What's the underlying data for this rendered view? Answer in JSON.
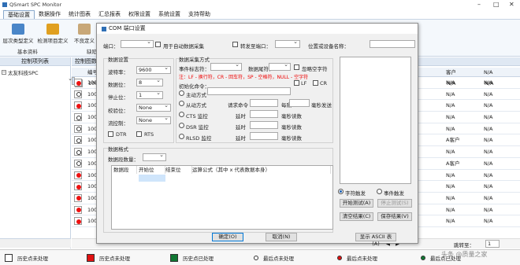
{
  "app": {
    "title": "QSmart SPC Monitor"
  },
  "menu": {
    "tabs": [
      "基础设置",
      "数据操作",
      "统计图表",
      "汇总报表",
      "权限设置",
      "系统设置",
      "支持帮助"
    ]
  },
  "ribbon": {
    "buttons": [
      "层次类型定义",
      "检测项目定义",
      "不良定义"
    ],
    "groups": [
      "基本资料",
      "缺陷"
    ]
  },
  "left_panel": {
    "header": "控制项列表",
    "tree_root": "太友科技SPC"
  },
  "main_panel": {
    "header": "控制图数量"
  },
  "table": {
    "columns": {
      "code": "编号",
      "customer": "客户",
      "extra": "N/A"
    },
    "rows": [
      {
        "status": "green",
        "code": "100",
        "col_a": "N/A",
        "col_b": "N/A",
        "selected": true
      },
      {
        "status": "red",
        "code": "100",
        "col_a": "N/A",
        "col_b": "N/A"
      },
      {
        "status": "hollow",
        "code": "100",
        "col_a": "N/A",
        "col_b": "N/A"
      },
      {
        "status": "red",
        "code": "100",
        "col_a": "N/A",
        "col_b": "N/A"
      },
      {
        "status": "hollow",
        "code": "100",
        "col_a": "N/A",
        "col_b": "N/A"
      },
      {
        "status": "hollow",
        "code": "100",
        "col_a": "N/A",
        "col_b": "N/A"
      },
      {
        "status": "hollow",
        "code": "100",
        "col_a": "A客户",
        "col_b": "N/A"
      },
      {
        "status": "hollow",
        "code": "100",
        "col_a": "N/A",
        "col_b": "N/A"
      },
      {
        "status": "hollow",
        "code": "100",
        "col_a": "A客户",
        "col_b": "N/A"
      },
      {
        "status": "red",
        "code": "100",
        "col_a": "N/A",
        "col_b": "N/A"
      },
      {
        "status": "red",
        "code": "100",
        "col_a": "N/A",
        "col_b": "N/A"
      },
      {
        "status": "red",
        "code": "100",
        "col_a": "N/A",
        "col_b": "N/A"
      },
      {
        "status": "red",
        "code": "100",
        "col_a": "N/A",
        "col_b": "N/A"
      },
      {
        "status": "red",
        "code": "100",
        "col_a": "N/A",
        "col_b": "N/A"
      }
    ]
  },
  "pager": {
    "jump_label": "跳转至：",
    "page": "1"
  },
  "legend": [
    {
      "label": "历史点未处理",
      "kind": "square",
      "color": "#ffffff"
    },
    {
      "label": "历史点未处理",
      "kind": "square",
      "color": "#e11111"
    },
    {
      "label": "历史点已处理",
      "kind": "square",
      "color": "#117733"
    },
    {
      "label": "最后点未处理",
      "kind": "circle",
      "color": "#ffffff"
    },
    {
      "label": "最后点未处理",
      "kind": "circle",
      "color": "#e11111"
    },
    {
      "label": "最后点已处理",
      "kind": "circle",
      "color": "#117733"
    }
  ],
  "watermark": "头条 @质量之家",
  "dialog": {
    "title": "COM 端口设置",
    "port_label": "端口：",
    "auto_detect_label": "用于自动数据采集",
    "forward_label": "转发至端口：",
    "device_name_label": "位置或设备名称：",
    "params_group": "数据设置",
    "baud_label": "波特率：",
    "baud_value": "9600",
    "databits_label": "数据位：",
    "databits_value": "8",
    "stopbits_label": "停止位：",
    "stopbits_value": "1",
    "parity_label": "校验位：",
    "parity_value": "None",
    "flow_label": "流控制：",
    "flow_value": "None",
    "dtr_label": "DTR",
    "rts_label": "RTS",
    "collect_group": "数据采集方式",
    "event_flag_label": "事件标志符：",
    "data_end_label": "数据尾符：",
    "ignore_blank_label": "忽略空字符",
    "hint": "注：LF - 换行符，CR - 回车符，SP - 空格符，NULL - 空字符",
    "init_cmd_label": "初始化命令：",
    "lf_label": "LF",
    "cr_label": "CR",
    "active_label": "主动方式",
    "passive_label": "从动方式",
    "request_cmd_label": "请求命令",
    "interval_label": "每隔",
    "send_label": "毫秒发送",
    "cts_label": "CTS 监控",
    "dsr_label": "DSR 监控",
    "rlsd_label": "RLSD 监控",
    "delay_label": "延时",
    "read_label": "毫秒读数",
    "format_group": "数据格式",
    "field_count_label": "数据段数量：",
    "grid_headers": [
      "数据段",
      "开始位",
      "结束位",
      "运算公式（其中 x 代表数据本身）"
    ],
    "char_trigger_label": "字符触发",
    "event_trigger_label": "事件触发",
    "start_test_label": "开始测试(A)",
    "stop_test_label": "停止测试(S)",
    "clear_result_label": "清空结果(C)",
    "save_result_label": "保存结果(V)",
    "ok_label": "确定(O)",
    "cancel_label": "取消(N)",
    "ascii_label": "显示 ASCII 表(A)"
  }
}
